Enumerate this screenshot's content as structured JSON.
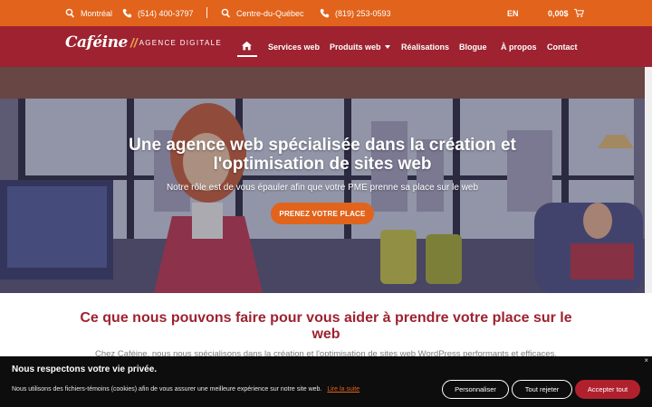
{
  "topbar": {
    "city1": "Montréal",
    "phone1": "(514) 400-3797",
    "city2": "Centre-du-Québec",
    "phone2": "(819) 253-0593",
    "lang": "EN",
    "cart": "0,00$"
  },
  "logo": {
    "brand": "Caféine",
    "tagline": "AGENCE DIGITALE"
  },
  "nav": {
    "services": "Services web",
    "products": "Produits web",
    "work": "Réalisations",
    "blog": "Blogue",
    "about": "À propos",
    "contact": "Contact"
  },
  "hero": {
    "title": "Une agence web spécialisée dans la création et l'optimisation de sites web",
    "subtitle": "Notre rôle est de vous épauler afin que votre PME prenne sa place sur le web",
    "cta": "PRENEZ VOTRE PLACE"
  },
  "section": {
    "title": "Ce que nous pouvons faire pour vous aider à prendre votre place sur le web",
    "text": "Chez Caféine, nous nous spécialisons dans la création et l'optimisation de sites web WordPress performants et efficaces."
  },
  "cookie": {
    "title": "Nous respectons votre vie privée.",
    "text": "Nous utilisons des fichiers-témoins (cookies) afin de vous assurer une meilleure expérience sur notre site web.",
    "more": "Lire la suite",
    "customize": "Personnaliser",
    "reject": "Tout rejeter",
    "accept": "Accepter tout",
    "close": "×"
  },
  "colors": {
    "topbar": "#e2631b",
    "nav": "#9e2230",
    "accent": "#e2631b",
    "section_title": "#9e2230"
  }
}
